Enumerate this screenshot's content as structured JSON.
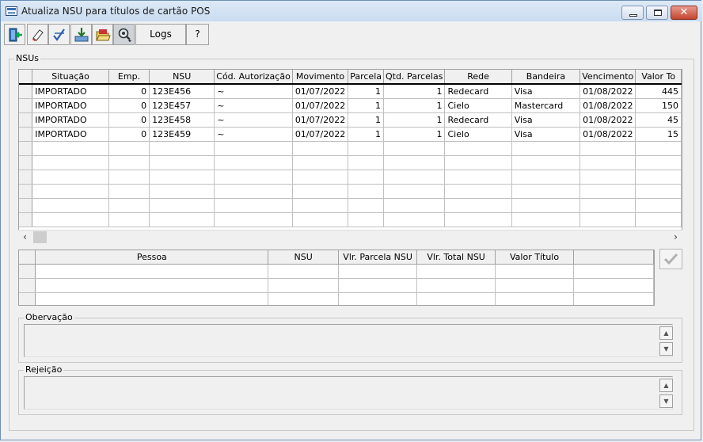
{
  "window": {
    "title": "Atualiza NSU para títulos de cartão POS"
  },
  "toolbar": {
    "logs_label": "Logs",
    "help_label": "?"
  },
  "nsus": {
    "legend": "NSUs",
    "columns": [
      "Situação",
      "Emp.",
      "NSU",
      "Cód. Autorização",
      "Movimento",
      "Parcela",
      "Qtd. Parcelas",
      "Rede",
      "Bandeira",
      "Vencimento",
      "Valor To"
    ],
    "rows": [
      {
        "situacao": "IMPORTADO",
        "emp": "0",
        "nsu": "123E456",
        "cod": "~",
        "movimento": "01/07/2022",
        "parcela": "1",
        "qtd": "1",
        "rede": "Redecard",
        "bandeira": "Visa",
        "vencimento": "01/08/2022",
        "valor": "445"
      },
      {
        "situacao": "IMPORTADO",
        "emp": "0",
        "nsu": "123E457",
        "cod": "~",
        "movimento": "01/07/2022",
        "parcela": "1",
        "qtd": "1",
        "rede": "Cielo",
        "bandeira": "Mastercard",
        "vencimento": "01/08/2022",
        "valor": "150"
      },
      {
        "situacao": "IMPORTADO",
        "emp": "0",
        "nsu": "123E458",
        "cod": "~",
        "movimento": "01/07/2022",
        "parcela": "1",
        "qtd": "1",
        "rede": "Redecard",
        "bandeira": "Visa",
        "vencimento": "01/08/2022",
        "valor": "45"
      },
      {
        "situacao": "IMPORTADO",
        "emp": "0",
        "nsu": "123E459",
        "cod": "~",
        "movimento": "01/07/2022",
        "parcela": "1",
        "qtd": "1",
        "rede": "Cielo",
        "bandeira": "Visa",
        "vencimento": "01/08/2022",
        "valor": "15"
      }
    ],
    "empty_rows": 6
  },
  "titulos": {
    "columns": [
      "Pessoa",
      "NSU",
      "Vlr. Parcela NSU",
      "Vlr. Total NSU",
      "Valor Título",
      ""
    ],
    "empty_rows": 3
  },
  "observacao": {
    "legend": "Obervação",
    "value": ""
  },
  "rejeicao": {
    "legend": "Rejeição",
    "value": ""
  },
  "colors": {
    "title_bar": "#dde9f6",
    "close_button": "#c3452f",
    "grid_header": "#f0f0f0"
  }
}
